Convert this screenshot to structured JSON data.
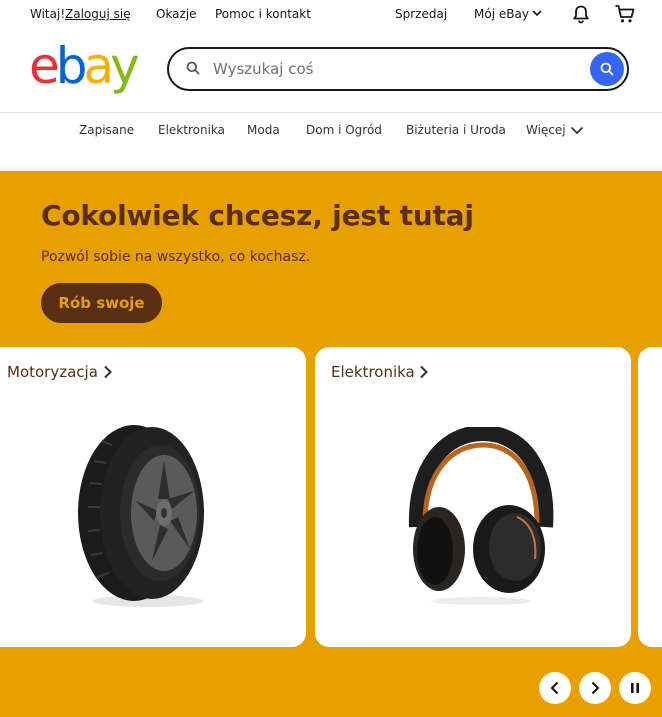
{
  "topbar": {
    "greeting": "Witaj!",
    "login_link": "Zaloguj się",
    "deals": "Okazje",
    "help": "Pomoc i kontakt",
    "sell": "Sprzedaj",
    "my_ebay": "Mój eBay",
    "icons": [
      "chevron-down-icon",
      "bell-icon",
      "cart-icon"
    ]
  },
  "header": {
    "logo_letters": [
      "e",
      "b",
      "a",
      "y"
    ],
    "logo_colors": [
      "#e53238",
      "#0064d2",
      "#f5af02",
      "#86b817"
    ],
    "search_placeholder": "Wyszukaj coś",
    "search_value": ""
  },
  "nav": {
    "items": [
      "Zapisane",
      "Elektronika",
      "Moda",
      "Dom i Ogród",
      "Biżuteria i Uroda",
      "Więcej"
    ]
  },
  "hero": {
    "title": "Cokolwiek chcesz, jest tutaj",
    "subtitle": "Pozwól sobie na wszystko, co kochasz.",
    "cta": "Rób swoje",
    "background": "#e89f00",
    "text_color": "#592e13",
    "cards": [
      {
        "label": "Motoryzacja",
        "image": "tire-image"
      },
      {
        "label": "Elektronika",
        "image": "headphones-image"
      }
    ],
    "controls": [
      "chevron-left-icon",
      "chevron-right-icon",
      "pause-icon"
    ]
  },
  "colors": {
    "accent": "#3665f3",
    "text": "#111820"
  }
}
